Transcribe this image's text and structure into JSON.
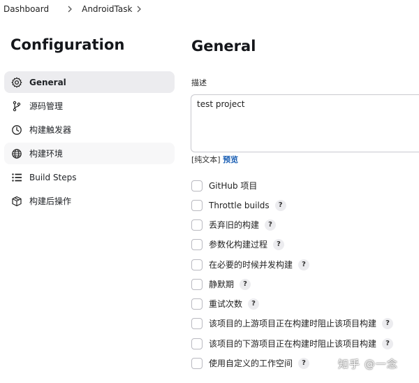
{
  "breadcrumb": {
    "items": [
      "Dashboard",
      "AndroidTask"
    ]
  },
  "sidebar": {
    "title": "Configuration",
    "items": [
      {
        "label": "General",
        "icon": "gear-icon",
        "active": true
      },
      {
        "label": "源码管理",
        "icon": "branch-icon"
      },
      {
        "label": "构建触发器",
        "icon": "clock-icon"
      },
      {
        "label": "构建环境",
        "icon": "globe-icon"
      },
      {
        "label": "Build Steps",
        "icon": "list-icon"
      },
      {
        "label": "构建后操作",
        "icon": "package-icon"
      }
    ]
  },
  "main": {
    "title": "General",
    "description": {
      "label": "描述",
      "value": "test project",
      "plain_text": "[纯文本]",
      "preview": "预览"
    },
    "options": [
      {
        "label": "GitHub 项目",
        "help": false,
        "checked": false
      },
      {
        "label": "Throttle builds",
        "help": true,
        "checked": false
      },
      {
        "label": "丢弃旧的构建",
        "help": true,
        "checked": false
      },
      {
        "label": "参数化构建过程",
        "help": true,
        "checked": false
      },
      {
        "label": "在必要的时候并发构建",
        "help": true,
        "checked": false
      },
      {
        "label": "静默期",
        "help": true,
        "checked": false
      },
      {
        "label": "重试次数",
        "help": true,
        "checked": false
      },
      {
        "label": "该项目的上游项目正在构建时阻止该项目构建",
        "help": true,
        "checked": false
      },
      {
        "label": "该项目的下游项目正在构建时阻止该项目构建",
        "help": true,
        "checked": false
      },
      {
        "label": "使用自定义的工作空间",
        "help": true,
        "checked": false
      }
    ],
    "help_glyph": "?"
  },
  "watermark": "知乎 @一念",
  "colors": {
    "active_bg": "#ececef",
    "link": "#1a5fb4",
    "border": "#c9c9cf"
  }
}
